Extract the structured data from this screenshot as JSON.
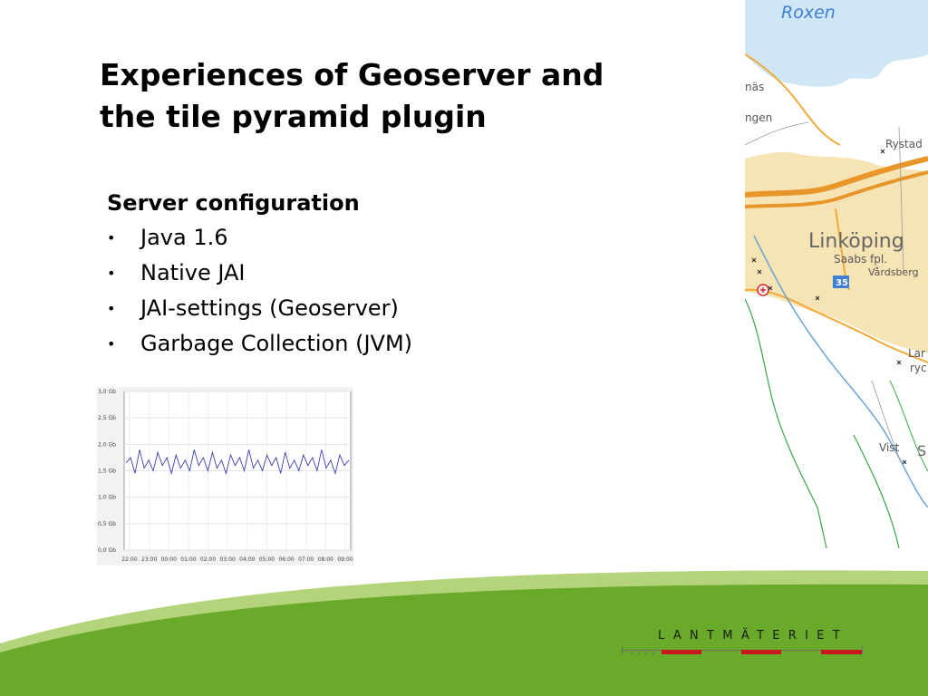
{
  "slide": {
    "title_line1": "Experiences of Geoserver and",
    "title_line2": "the tile pyramid plugin",
    "subheading": "Server configuration",
    "bullets": [
      "Java 1.6",
      "Native JAI",
      "JAI-settings (Geoserver)",
      "Garbage Collection (JVM)"
    ]
  },
  "map": {
    "labels": {
      "lake": "Roxen",
      "nas": "näs",
      "ngen": "ngen",
      "rystad": "Rystad",
      "city": "Linköping",
      "saab": "Saabs fpl.",
      "vardsberg": "Vårdsberg",
      "road": "35",
      "lar": "Lar",
      "ryc": "ryc",
      "vist": "Vist",
      "s": "S"
    },
    "colors": {
      "water": "#cfe6f5",
      "urban": "#f6e4b4",
      "roads": "#f2a93b",
      "land": "#ffffff",
      "green": "#3aa64a",
      "road_sign": "#3f7fd3"
    }
  },
  "memory_chart": {
    "chart_data": {
      "type": "line",
      "title": "",
      "xlabel": "",
      "ylabel": "",
      "categories": [
        "22:00",
        "23:00",
        "00:00",
        "01:00",
        "02:00",
        "03:00",
        "04:00",
        "05:00",
        "06:00",
        "07:00",
        "08:00",
        "09:00"
      ],
      "y_ticks": [
        "0,0 Gb",
        "0,5 Gb",
        "1,0 Gb",
        "1,5 Gb",
        "2,0 Gb",
        "2,5 Gb",
        "3,0 Gb"
      ],
      "ylim": [
        0,
        3.0
      ],
      "grid": true,
      "series": [
        {
          "values": [
            1.65,
            1.75,
            1.45,
            1.9,
            1.55,
            1.7,
            1.5,
            1.85,
            1.6,
            1.75,
            1.45,
            1.8,
            1.55,
            1.7,
            1.5,
            1.9,
            1.6,
            1.75,
            1.5,
            1.85,
            1.55,
            1.7,
            1.45,
            1.8,
            1.6,
            1.75,
            1.5,
            1.9,
            1.55,
            1.7,
            1.5,
            1.8,
            1.6,
            1.75,
            1.45,
            1.85,
            1.55,
            1.7,
            1.5,
            1.8,
            1.6,
            1.75,
            1.5,
            1.9,
            1.55,
            1.7,
            1.45,
            1.8,
            1.6,
            1.7
          ]
        }
      ],
      "color": "#3b3fae"
    }
  },
  "footer": {
    "logo_text": "LANTMÄTERIET",
    "colors": {
      "green_dark": "#6aaa2a",
      "green_light": "#b4d47c",
      "logo_red": "#c8161d",
      "logo_gray": "#6e6e6e"
    }
  }
}
